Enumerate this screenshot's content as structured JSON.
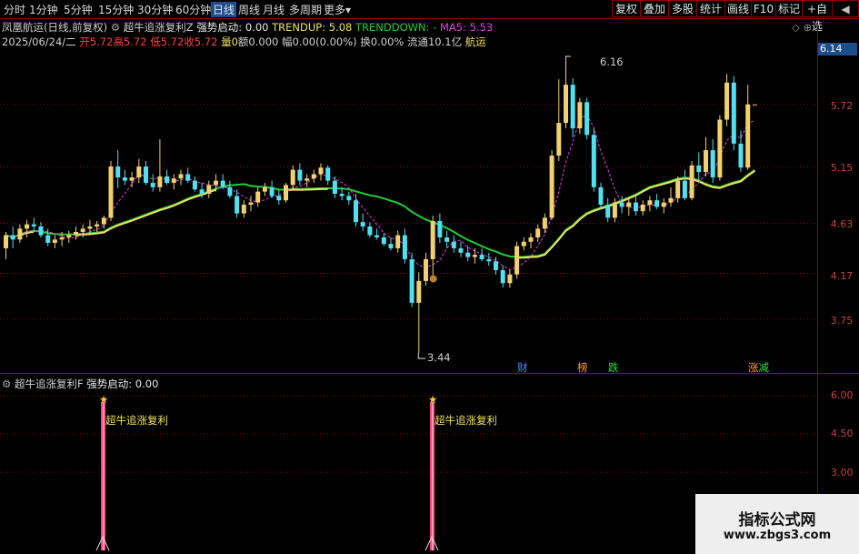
{
  "tabs": [
    "分时",
    "1分钟",
    "5分钟",
    "15分钟",
    "30分钟",
    "60分钟",
    "日线",
    "周线",
    "月线",
    "多周期",
    "更多"
  ],
  "tab_more_arrow": "▾",
  "toolbar": [
    "复权",
    "叠加",
    "多股",
    "统计",
    "画线",
    "F10",
    "标记",
    "+自选",
    "◀"
  ],
  "info": {
    "stock": "凤凰航运(日线,前复权)",
    "indicator_name": "超牛追涨复利Z",
    "signal_label": "强势启动: 0.00",
    "trendup": "TRENDUP: 5.08",
    "trenddown": "TRENDDOWN: -",
    "ma5": "MA5: 5.53",
    "line2_date": "2025/06/24/二",
    "line2_open": "开5.72",
    "line2_high": "高5.72",
    "line2_low": "低5.72",
    "line2_close": "收5.72",
    "line2_vol_label": "量0",
    "line2_amt": "额0.000",
    "line2_range": "幅0.00(0.00%)",
    "line2_turnover": "换0.00%",
    "line2_float": "流通10.1亿",
    "line2_sector": "航运",
    "corner_icons": "◇ ⊕"
  },
  "current_price": "6.14",
  "price_ticks": [
    "5.72",
    "5.15",
    "4.63",
    "4.17",
    "3.75"
  ],
  "extremes": {
    "high": "6.16",
    "low": "3.44"
  },
  "event_tags": [
    {
      "text": "财",
      "color": "#4a8cff"
    },
    {
      "text": "榜",
      "color": "#ff9933"
    },
    {
      "text": "跌",
      "color": "#33dd33"
    },
    {
      "text": "涨",
      "color": "#ff9933"
    },
    {
      "text": "减",
      "color": "#33dd33"
    }
  ],
  "sub_panel": {
    "title": "超牛追涨复利F",
    "signal_label": "强势启动: 0.00",
    "ticks": [
      "6.00",
      "4.50",
      "3.00"
    ],
    "marker_text": "超牛追涨复利",
    "marker_glyph": "★"
  },
  "colors": {
    "up": "#f0d070",
    "down": "#50e0f0",
    "ma_green": "#22cc33",
    "ma_yellow": "#f0e060",
    "ma5": "#e040e0",
    "grid": "#a00000"
  },
  "chart_data": {
    "type": "candlestick",
    "y_range": [
      3.44,
      6.16
    ],
    "candles": [
      [
        4.4,
        4.55,
        4.3,
        4.52
      ],
      [
        4.52,
        4.6,
        4.4,
        4.48
      ],
      [
        4.48,
        4.62,
        4.45,
        4.58
      ],
      [
        4.58,
        4.66,
        4.5,
        4.62
      ],
      [
        4.62,
        4.68,
        4.55,
        4.6
      ],
      [
        4.6,
        4.64,
        4.5,
        4.52
      ],
      [
        4.52,
        4.58,
        4.42,
        4.45
      ],
      [
        4.45,
        4.52,
        4.4,
        4.48
      ],
      [
        4.48,
        4.55,
        4.42,
        4.5
      ],
      [
        4.5,
        4.56,
        4.45,
        4.52
      ],
      [
        4.52,
        4.6,
        4.48,
        4.55
      ],
      [
        4.55,
        4.62,
        4.5,
        4.58
      ],
      [
        4.58,
        4.66,
        4.52,
        4.6
      ],
      [
        4.6,
        4.65,
        4.55,
        4.62
      ],
      [
        4.62,
        4.7,
        4.58,
        4.68
      ],
      [
        4.68,
        5.2,
        4.65,
        5.15
      ],
      [
        5.15,
        5.3,
        4.95,
        5.05
      ],
      [
        5.05,
        5.12,
        4.98,
        5.02
      ],
      [
        5.02,
        5.1,
        4.96,
        5.05
      ],
      [
        5.05,
        5.22,
        5.0,
        5.15
      ],
      [
        5.15,
        5.2,
        4.98,
        5.0
      ],
      [
        5.0,
        5.08,
        4.92,
        4.96
      ],
      [
        4.96,
        5.4,
        4.92,
        5.06
      ],
      [
        5.06,
        5.12,
        4.98,
        5.0
      ],
      [
        5.0,
        5.08,
        4.94,
        5.04
      ],
      [
        5.04,
        5.12,
        4.98,
        5.08
      ],
      [
        5.08,
        5.14,
        5.0,
        5.02
      ],
      [
        5.02,
        5.06,
        4.92,
        4.94
      ],
      [
        4.94,
        5.0,
        4.86,
        4.9
      ],
      [
        4.9,
        5.02,
        4.86,
        4.98
      ],
      [
        4.98,
        5.08,
        4.92,
        5.02
      ],
      [
        5.02,
        5.08,
        4.94,
        4.96
      ],
      [
        4.96,
        5.02,
        4.86,
        4.88
      ],
      [
        4.88,
        4.94,
        4.68,
        4.72
      ],
      [
        4.72,
        4.84,
        4.68,
        4.8
      ],
      [
        4.8,
        4.88,
        4.74,
        4.82
      ],
      [
        4.82,
        4.96,
        4.78,
        4.92
      ],
      [
        4.92,
        5.0,
        4.88,
        4.96
      ],
      [
        4.96,
        5.02,
        4.86,
        4.88
      ],
      [
        4.88,
        4.94,
        4.8,
        4.84
      ],
      [
        4.84,
        5.0,
        4.82,
        4.98
      ],
      [
        4.98,
        5.16,
        4.94,
        5.12
      ],
      [
        5.12,
        5.18,
        4.98,
        5.02
      ],
      [
        5.02,
        5.08,
        4.96,
        5.04
      ],
      [
        5.04,
        5.12,
        5.0,
        5.08
      ],
      [
        5.08,
        5.18,
        5.02,
        5.14
      ],
      [
        5.14,
        5.16,
        4.98,
        5.02
      ],
      [
        5.02,
        5.06,
        4.86,
        4.9
      ],
      [
        4.9,
        4.96,
        4.84,
        4.88
      ],
      [
        4.88,
        4.92,
        4.8,
        4.84
      ],
      [
        4.84,
        4.9,
        4.6,
        4.64
      ],
      [
        4.64,
        4.72,
        4.56,
        4.6
      ],
      [
        4.6,
        4.64,
        4.5,
        4.52
      ],
      [
        4.52,
        4.58,
        4.48,
        4.5
      ],
      [
        4.5,
        4.54,
        4.42,
        4.44
      ],
      [
        4.44,
        4.5,
        4.38,
        4.4
      ],
      [
        4.4,
        4.56,
        4.36,
        4.52
      ],
      [
        4.52,
        4.58,
        4.26,
        4.3
      ],
      [
        4.3,
        4.36,
        3.86,
        3.9
      ],
      [
        3.9,
        4.18,
        3.44,
        4.1
      ],
      [
        4.1,
        4.36,
        4.06,
        4.3
      ],
      [
        4.3,
        4.7,
        4.12,
        4.65
      ],
      [
        4.65,
        4.72,
        4.45,
        4.5
      ],
      [
        4.5,
        4.56,
        4.4,
        4.46
      ],
      [
        4.46,
        4.52,
        4.36,
        4.4
      ],
      [
        4.4,
        4.46,
        4.32,
        4.36
      ],
      [
        4.36,
        4.42,
        4.28,
        4.32
      ],
      [
        4.32,
        4.4,
        4.26,
        4.34
      ],
      [
        4.34,
        4.4,
        4.28,
        4.3
      ],
      [
        4.3,
        4.36,
        4.24,
        4.28
      ],
      [
        4.28,
        4.32,
        4.16,
        4.2
      ],
      [
        4.2,
        4.24,
        4.04,
        4.08
      ],
      [
        4.08,
        4.2,
        4.04,
        4.16
      ],
      [
        4.16,
        4.46,
        4.12,
        4.42
      ],
      [
        4.42,
        4.5,
        4.38,
        4.46
      ],
      [
        4.46,
        4.54,
        4.4,
        4.5
      ],
      [
        4.5,
        4.62,
        4.46,
        4.58
      ],
      [
        4.58,
        4.72,
        4.54,
        4.68
      ],
      [
        4.68,
        5.3,
        4.66,
        5.25
      ],
      [
        5.25,
        5.95,
        5.2,
        5.55
      ],
      [
        5.55,
        6.16,
        5.5,
        5.9
      ],
      [
        5.9,
        5.96,
        5.42,
        5.5
      ],
      [
        5.5,
        5.78,
        5.45,
        5.74
      ],
      [
        5.74,
        5.78,
        5.4,
        5.44
      ],
      [
        5.44,
        5.5,
        4.92,
        4.96
      ],
      [
        4.96,
        5.0,
        4.76,
        4.8
      ],
      [
        4.8,
        4.86,
        4.64,
        4.68
      ],
      [
        4.68,
        4.86,
        4.64,
        4.82
      ],
      [
        4.82,
        4.88,
        4.72,
        4.78
      ],
      [
        4.78,
        4.86,
        4.7,
        4.82
      ],
      [
        4.82,
        4.9,
        4.7,
        4.74
      ],
      [
        4.74,
        4.84,
        4.7,
        4.8
      ],
      [
        4.8,
        4.88,
        4.74,
        4.84
      ],
      [
        4.84,
        4.9,
        4.76,
        4.78
      ],
      [
        4.78,
        4.86,
        4.72,
        4.82
      ],
      [
        4.82,
        4.96,
        4.78,
        4.86
      ],
      [
        4.86,
        5.06,
        4.82,
        5.02
      ],
      [
        5.02,
        5.12,
        4.84,
        4.86
      ],
      [
        4.86,
        5.2,
        4.84,
        5.16
      ],
      [
        5.16,
        5.28,
        5.02,
        5.1
      ],
      [
        5.1,
        5.42,
        5.06,
        5.3
      ],
      [
        5.3,
        5.4,
        5.0,
        5.05
      ],
      [
        5.05,
        5.62,
        5.02,
        5.58
      ],
      [
        5.58,
        6.0,
        5.52,
        5.92
      ],
      [
        5.92,
        5.98,
        5.3,
        5.36
      ],
      [
        5.36,
        5.48,
        5.1,
        5.14
      ],
      [
        5.14,
        5.9,
        5.12,
        5.72
      ],
      [
        5.72,
        5.72,
        5.72,
        5.72
      ]
    ],
    "indicator_signals": [
      8,
      55
    ],
    "sub_range": [
      0,
      6.6
    ]
  }
}
